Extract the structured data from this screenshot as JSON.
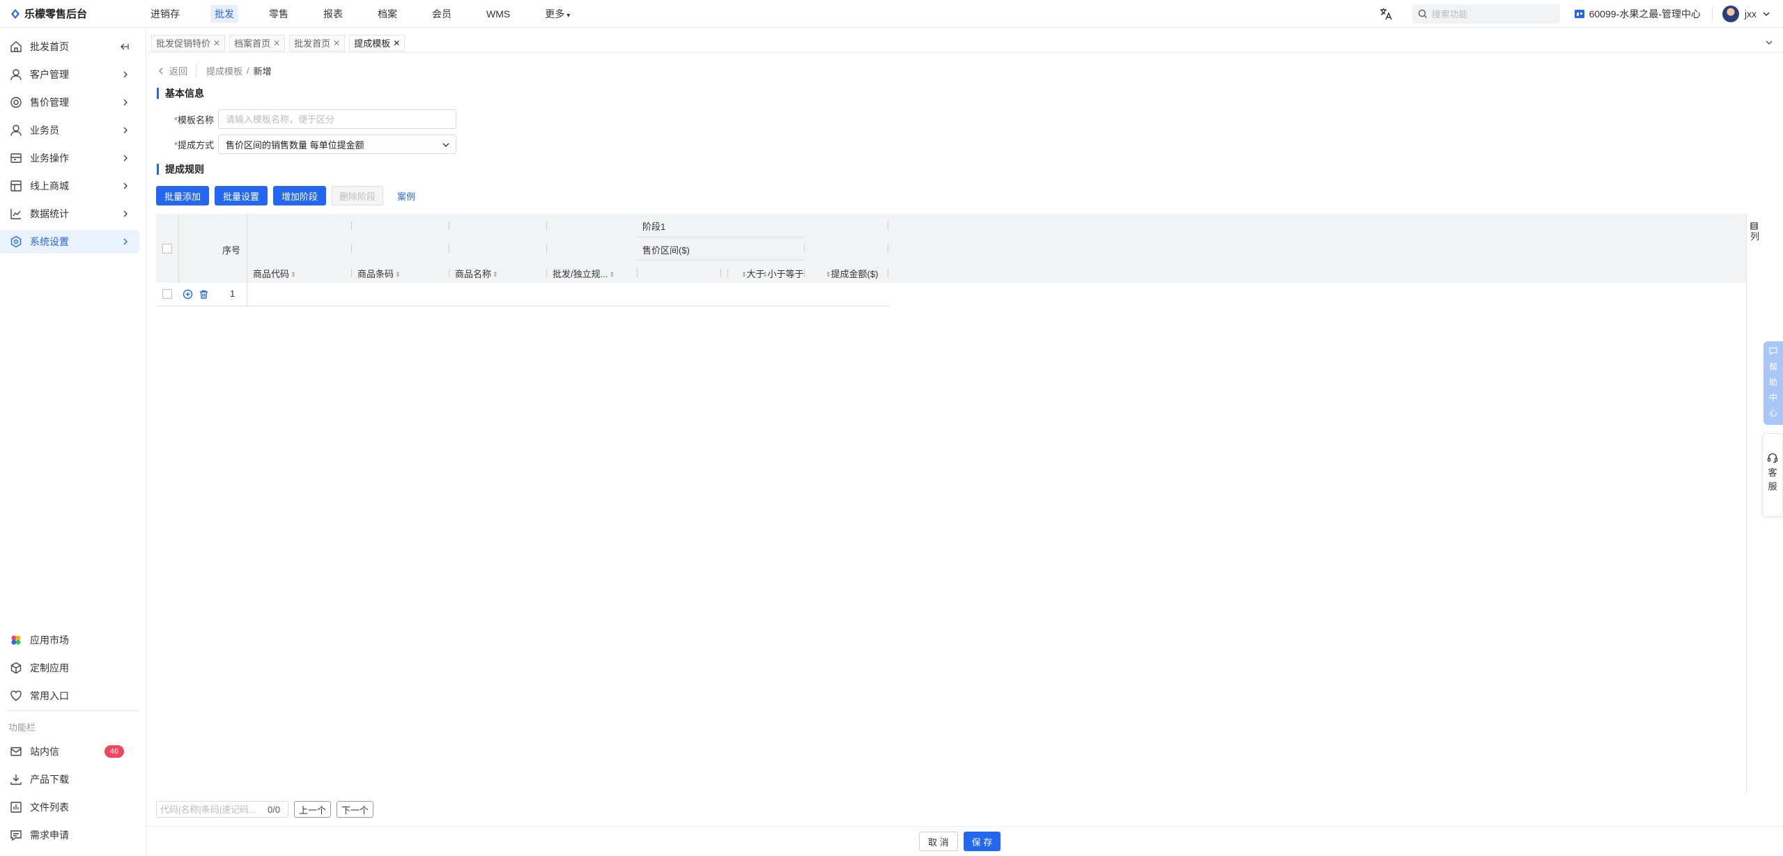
{
  "app": {
    "brand": "乐檬零售后台"
  },
  "topnav": {
    "items": [
      "进销存",
      "批发",
      "零售",
      "报表",
      "档案",
      "会员",
      "WMS",
      "更多"
    ],
    "active_index": 1
  },
  "header": {
    "search_placeholder": "搜索功能",
    "store": "60099-水果之最-管理中心",
    "user": "jxx"
  },
  "sidebar": {
    "items": [
      {
        "label": "批发首页",
        "icon": "home-icon"
      },
      {
        "label": "客户管理",
        "icon": "user-icon"
      },
      {
        "label": "售价管理",
        "icon": "price-icon"
      },
      {
        "label": "业务员",
        "icon": "user-icon"
      },
      {
        "label": "业务操作",
        "icon": "operation-icon"
      },
      {
        "label": "线上商城",
        "icon": "store-icon"
      },
      {
        "label": "数据统计",
        "icon": "chart-icon"
      },
      {
        "label": "系统设置",
        "icon": "settings-icon"
      }
    ],
    "active_index": 7,
    "bottom_items": [
      "应用市场",
      "定制应用",
      "常用入口"
    ],
    "function_label": "功能栏",
    "function_items": [
      "站内信",
      "产品下载",
      "文件列表",
      "需求申请"
    ],
    "message_badge": "46"
  },
  "tabs": [
    "批发促销特价",
    "档案首页",
    "批发首页",
    "提成模板"
  ],
  "active_tab": 3,
  "breadcrumb": {
    "back": "返回",
    "parent": "提成模板",
    "separator": "/",
    "current": "新增"
  },
  "basic_info": {
    "title": "基本信息",
    "name_label": "模板名称",
    "name_placeholder": "请输入模板名称，便于区分",
    "method_label": "提成方式",
    "method_value": "售价区间的销售数量 每单位提金额"
  },
  "rules": {
    "title": "提成规则",
    "buttons": {
      "batch_add": "批量添加",
      "batch_set": "批量设置",
      "add_stage": "增加阶段",
      "delete_stage": "删除阶段",
      "example": "案例"
    }
  },
  "table": {
    "seq_header": "序号",
    "stage_header": "阶段1",
    "range_header": "售价区间($)",
    "columns": [
      "商品代码",
      "商品条码",
      "商品名称",
      "批发/独立规...",
      "大于",
      "小于等于",
      "提成金额($)"
    ],
    "rows": [
      {
        "seq": "1"
      }
    ],
    "column_setting": "列"
  },
  "finder": {
    "placeholder": "代码|名称|条码|速记码...",
    "count": "0/0",
    "prev": "上一个",
    "next": "下一个"
  },
  "footer": {
    "cancel": "取 消",
    "save": "保 存"
  },
  "widgets": {
    "help": [
      "帮",
      "助",
      "中",
      "心"
    ],
    "service": [
      "客",
      "服"
    ]
  },
  "colors": {
    "primary": "#2468f2",
    "badge": "#f5455c",
    "header_bg": "#f2f3f5"
  }
}
